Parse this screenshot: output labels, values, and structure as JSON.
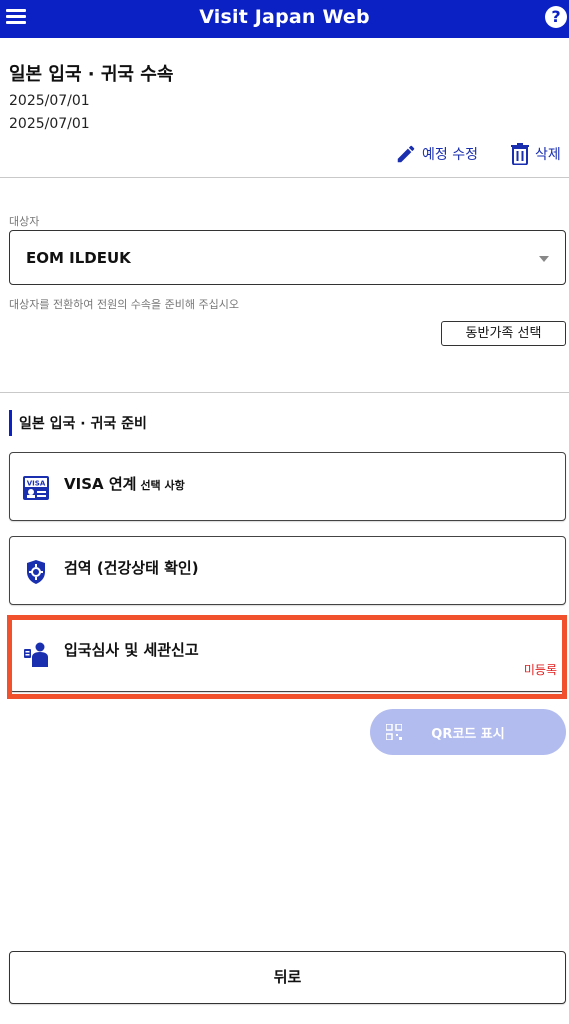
{
  "header": {
    "title": "Visit Japan Web",
    "menu_icon": "hamburger-menu-icon",
    "help_label": "?",
    "bg_color": "#0b21c4"
  },
  "trip": {
    "title": "일본 입국 · 귀국 수속",
    "date_start": "2025/07/01",
    "date_end": "2025/07/01",
    "edit_label": "예정 수정",
    "delete_label": "삭제"
  },
  "target": {
    "label": "대상자",
    "selected": "EOM ILDEUK",
    "hint": "대상자를 전환하여 전원의 수속을 준비해 주십시오",
    "family_button": "동반가족 선택"
  },
  "prep": {
    "section_title": "일본 입국 · 귀국 준비",
    "items": [
      {
        "icon": "visa-card-icon",
        "title": "VISA 연계",
        "subtitle": "선택 사항",
        "status": ""
      },
      {
        "icon": "quarantine-virus-icon",
        "title": "검역 (건강상태 확인)",
        "subtitle": "",
        "status": ""
      },
      {
        "icon": "immigration-officer-icon",
        "title": "입국심사 및 세관신고",
        "subtitle": "",
        "status": "미등록"
      }
    ]
  },
  "actions": {
    "qr_label": "QR코드 표시",
    "back_label": "뒤로"
  },
  "colors": {
    "accent": "#0b21c4",
    "highlight": "#f2512e",
    "status_unregistered": "#e02020",
    "qr_disabled": "#b3bcef"
  }
}
